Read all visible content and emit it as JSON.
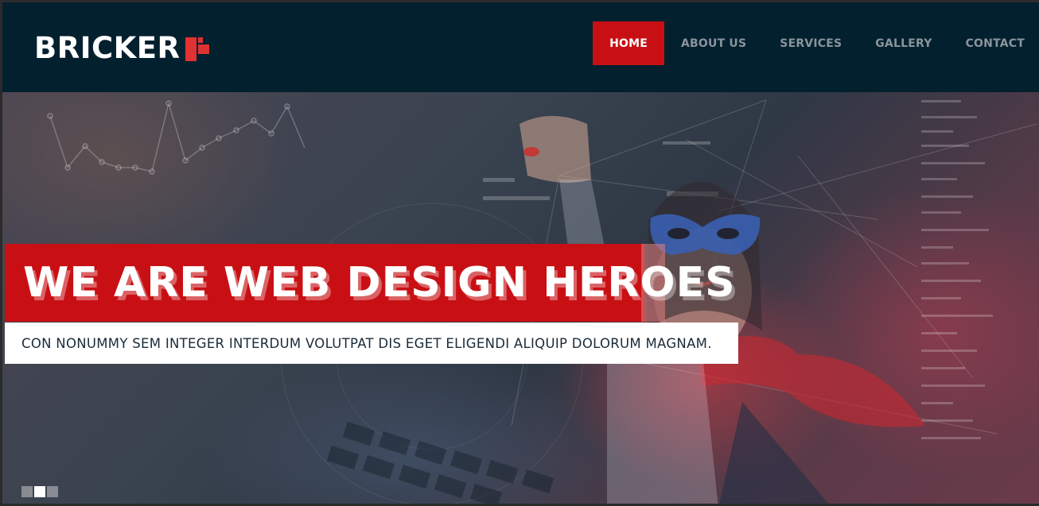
{
  "brand": {
    "name": "BRICKER",
    "accent": "#e03232"
  },
  "nav": {
    "items": [
      {
        "label": "HOME",
        "active": true
      },
      {
        "label": "ABOUT US",
        "active": false
      },
      {
        "label": "SERVICES",
        "active": false
      },
      {
        "label": "GALLERY",
        "active": false
      },
      {
        "label": "CONTACT",
        "active": false
      }
    ]
  },
  "hero": {
    "headline": "WE ARE WEB DESIGN HEROES",
    "subheadline": "CON NONUMMY SEM INTEGER INTERDUM VOLUTPAT DIS EGET ELIGENDI ALIQUIP DOLORUM MAGNAM.",
    "slider": {
      "slides": 3,
      "active_index": 1
    }
  },
  "colors": {
    "header_bg": "#03202f",
    "primary_red": "#c81014",
    "nav_text": "#8a949b"
  }
}
